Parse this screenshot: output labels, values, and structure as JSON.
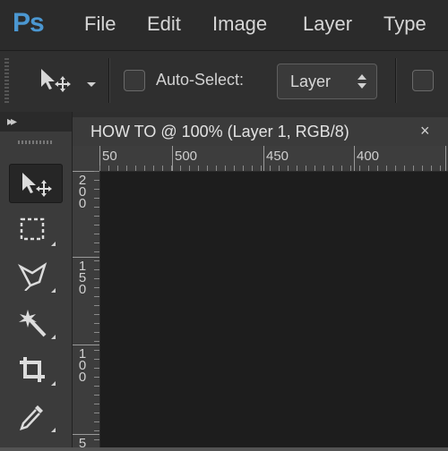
{
  "app": {
    "logo": "Ps"
  },
  "menu": {
    "items": [
      "File",
      "Edit",
      "Image",
      "Layer",
      "Type"
    ]
  },
  "options": {
    "auto_select_label": "Auto-Select:",
    "auto_select_value": "Layer"
  },
  "document": {
    "tab_title": "HOW TO @ 100% (Layer 1, RGB/8)",
    "close_glyph": "×"
  },
  "rulers": {
    "top_labels": [
      "50",
      "500",
      "450",
      "400"
    ],
    "left_labels": [
      "200",
      "150",
      "100",
      "5"
    ]
  },
  "tools": [
    "move-tool",
    "rectangular-marquee-tool",
    "polygonal-lasso-tool",
    "magic-wand-tool",
    "crop-tool",
    "eyedropper-tool"
  ],
  "colors": {
    "accent": "#4b97d1",
    "canvas": "#1d1d1d",
    "panel": "#3b3b3b"
  }
}
